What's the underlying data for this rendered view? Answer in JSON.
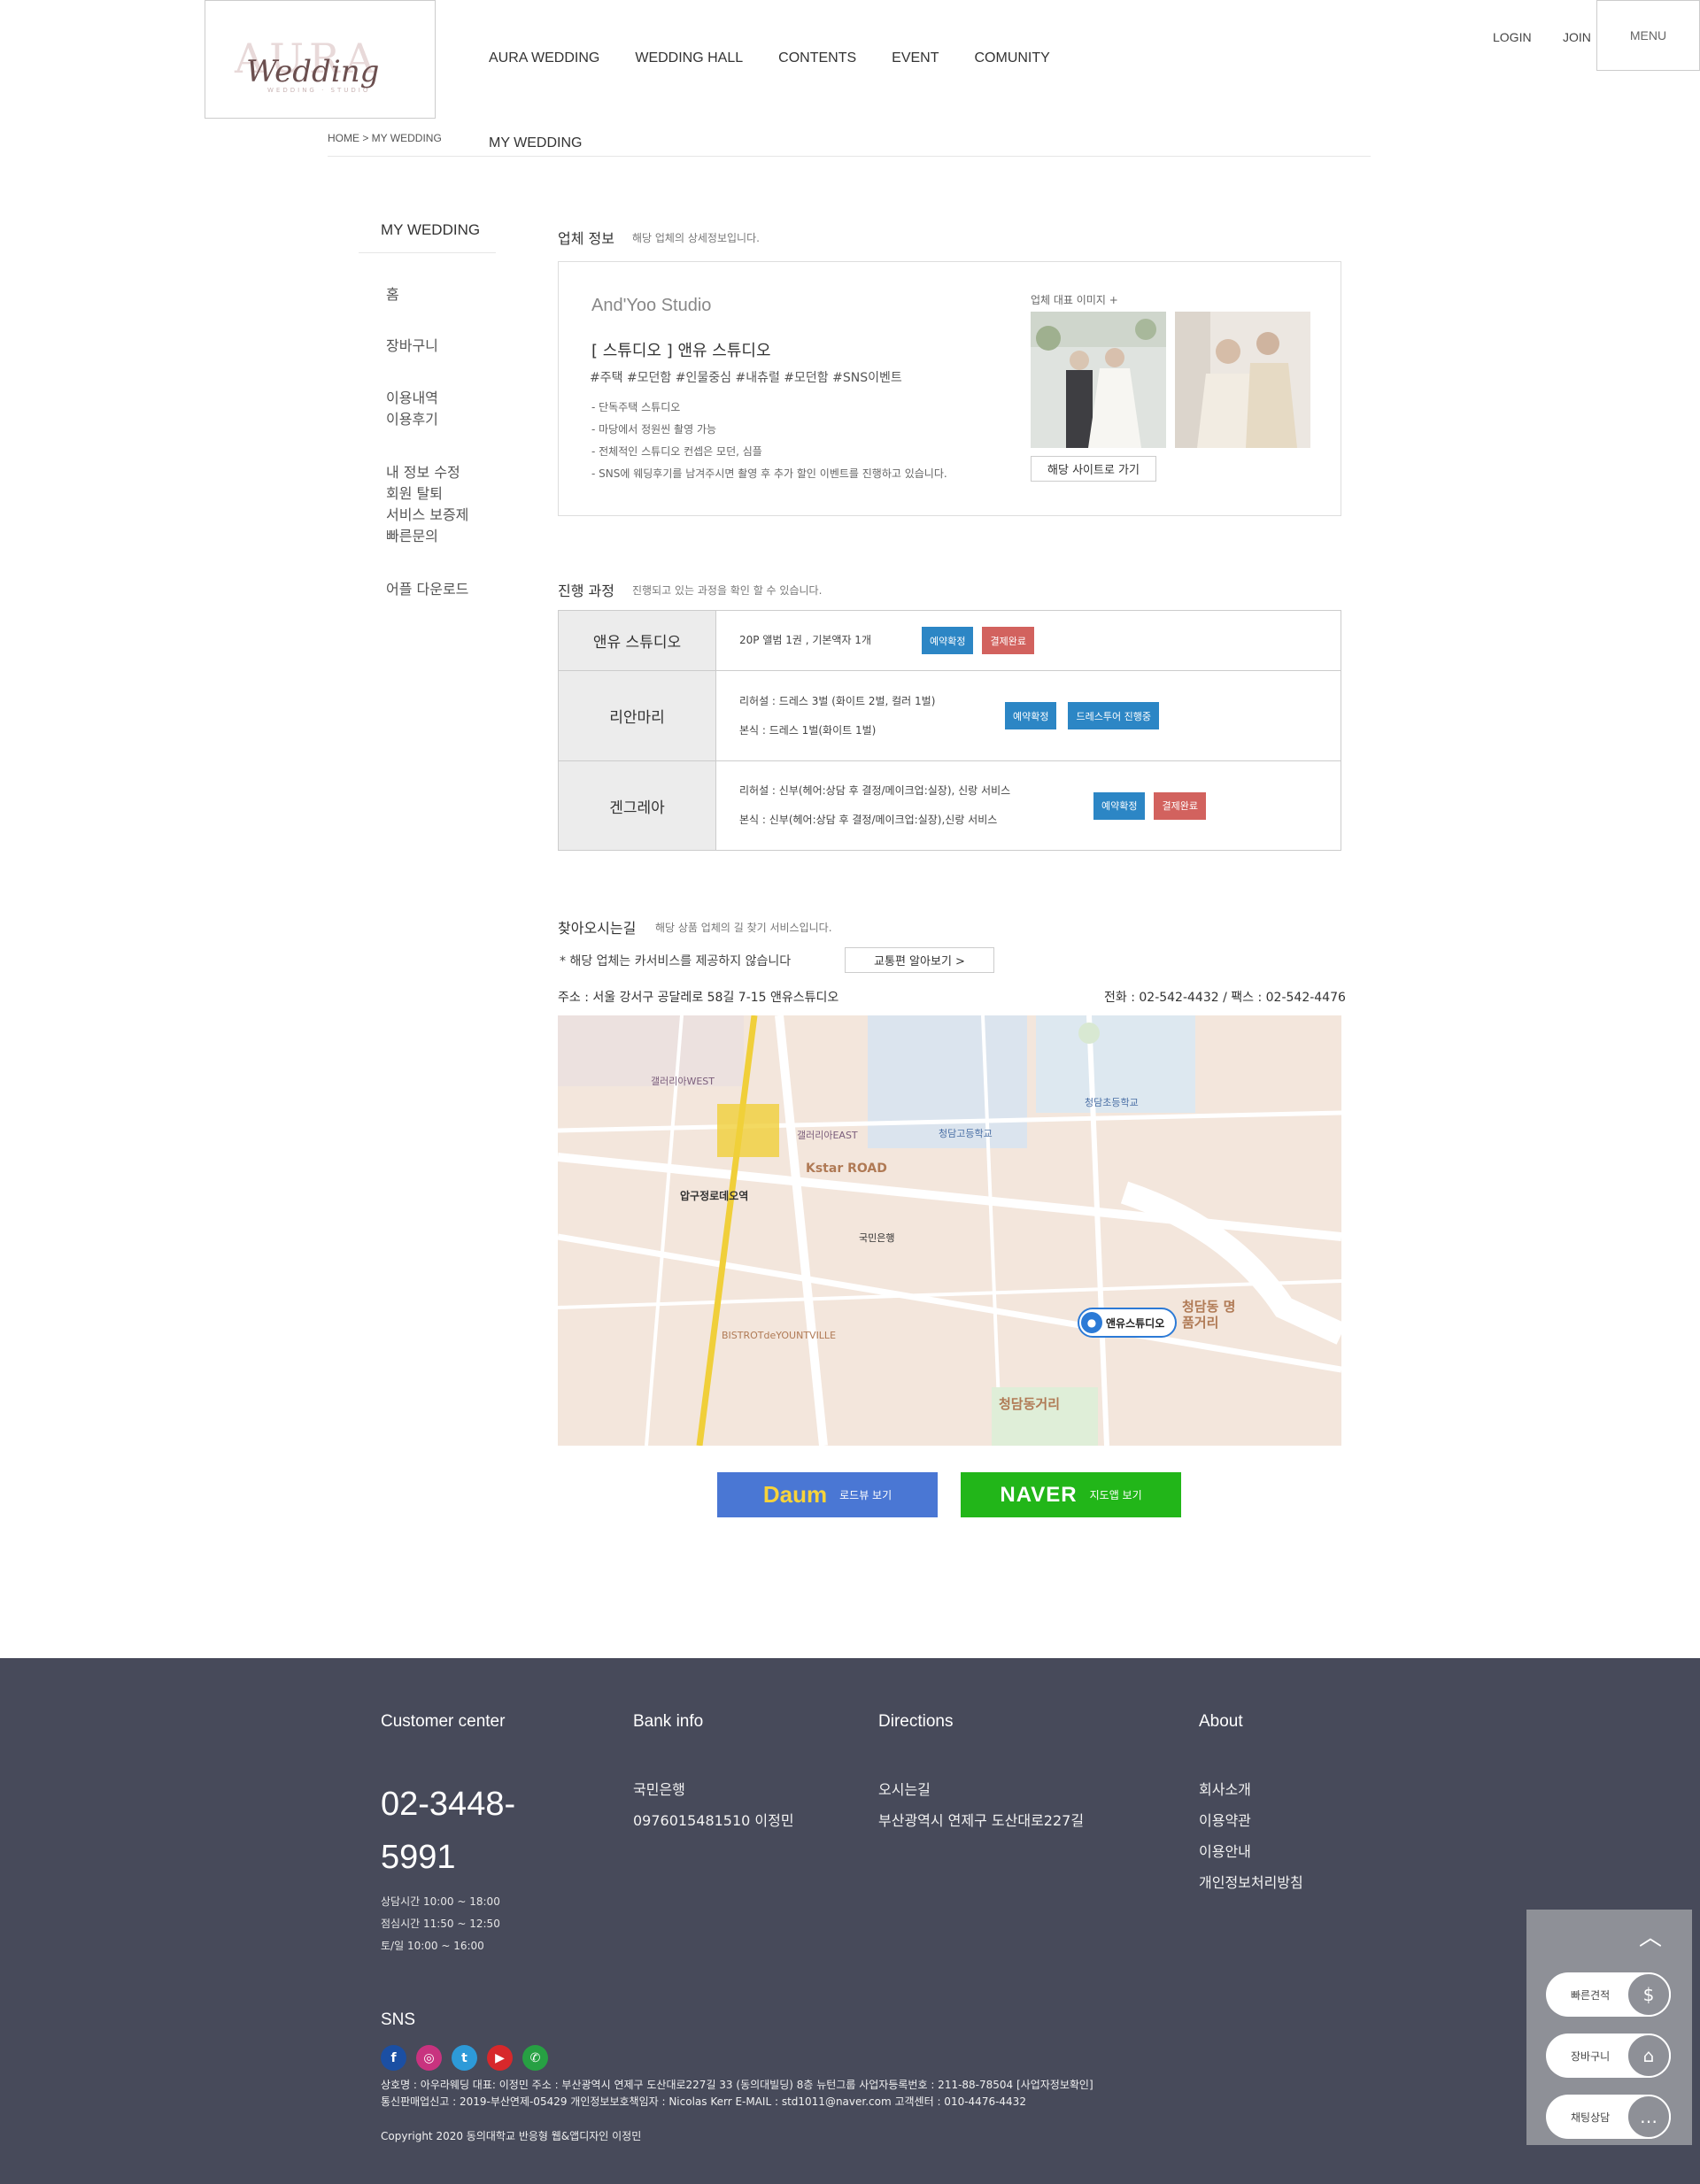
{
  "header": {
    "logo_top": "AURA",
    "logo_script": "Wedding",
    "logo_sub": "WEDDING · STUDIO",
    "nav": [
      "AURA WEDDING",
      "WEDDING HALL",
      "CONTENTS",
      "EVENT",
      "COMUNITY"
    ],
    "login": "LOGIN",
    "join": "JOIN",
    "menu": "MENU"
  },
  "breadcrumb": "HOME > MY WEDDING",
  "page_title": "MY WEDDING",
  "sidebar": {
    "title": "MY WEDDING",
    "items": [
      "홈",
      "장바구니",
      "이용내역",
      "이용후기",
      "내 정보 수정",
      "회원 탈퇴",
      "서비스 보증제",
      "빠른문의",
      "어플 다운로드"
    ]
  },
  "company": {
    "title": "업체 정보",
    "subtitle": "해당 업체의 상세정보입니다.",
    "name_en": "And'Yoo Studio",
    "name_ko": "[ 스튜디오 ] 앤유 스튜디오",
    "tags": "#주택 #모던함 #인물중심 #내츄럴 #모던함 #SNS이벤트",
    "desc": [
      "- 단독주택 스튜디오",
      "- 마당에서 정원씬 촬영 가능",
      "- 전체적인 스튜디오 컨셉은 모던, 심플",
      "- SNS에 웨딩후기를 남겨주시면 촬영 후 추가 할인 이벤트를 진행하고 있습니다."
    ],
    "image_label": "업체 대표 이미지 +",
    "site_button": "해당 사이트로 가기"
  },
  "progress": {
    "title": "진행 과정",
    "subtitle": "진행되고 있는 과정을 확인 할 수 있습니다.",
    "rows": [
      {
        "name": "앤유 스튜디오",
        "lines": [
          "20P 앨범 1권 , 기본액자 1개"
        ],
        "badges": [
          "예약확정",
          "결제완료"
        ]
      },
      {
        "name": "리안마리",
        "lines": [
          "리허설 : 드레스 3벌 (화이트 2벌, 컬러 1벌)",
          "본식 : 드레스 1벌(화이트 1벌)"
        ],
        "badges": [
          "예약확정",
          "드레스투어 진행중"
        ]
      },
      {
        "name": "겐그레아",
        "lines": [
          "리허설 : 신부(헤어:상담 후 결정/메이크업:실장), 신랑 서비스",
          "본식 : 신부(헤어:상담 후 결정/메이크업:실장),신랑 서비스"
        ],
        "badges": [
          "예약확정",
          "결제완료"
        ]
      }
    ]
  },
  "directions": {
    "title": "찾아오시는길",
    "subtitle": "해당 상품 업체의 길 찾기 서비스입니다.",
    "notice": "* 해당 업체는 카서비스를 제공하지 않습니다",
    "traffic_button": "교통편 알아보기 >",
    "address": "주소 : 서울 강서구 공달레로 58길 7-15 앤유스튜디오",
    "tel": "전화 : 02-542-4432 / 팩스 : 02-542-4476",
    "map_labels": {
      "station": "압구정로데오역",
      "road": "Kstar ROAD",
      "pin": "앤유스튜디오",
      "area": "청담동 명품거리",
      "street": "청담동거리",
      "bank": "국민은행",
      "gallery_w": "갤러리아WEST",
      "gallery_e": "갤러리아EAST",
      "bistrot": "BISTROTdeYOUNTVILLE",
      "school": "청담고등학교",
      "school2": "청담초등학교"
    },
    "daum_logo": "Daum",
    "daum_label": "로드뷰 보기",
    "naver_logo": "NAVER",
    "naver_label": "지도앱 보기"
  },
  "footer": {
    "customer": {
      "title": "Customer center",
      "phone_1": "02-3448-",
      "phone_2": "5991",
      "hours": [
        "상담시간 10:00 ~ 18:00",
        "점심시간 11:50 ~ 12:50",
        "토/일 10:00 ~ 16:00"
      ]
    },
    "bank": {
      "title": "Bank info",
      "lines": [
        "국민은행",
        "0976015481510 이정민"
      ]
    },
    "directions": {
      "title": "Directions",
      "lines": [
        "오시는길",
        "부산광역시 연제구 도산대로227길"
      ]
    },
    "about": {
      "title": "About",
      "lines": [
        "회사소개",
        "이용약관",
        "이용안내",
        "개인정보처리방침"
      ]
    },
    "sns_title": "SNS",
    "info_1": "상호명 : 아우라웨딩 대표: 이정민 주소 : 부산광역시 연제구 도산대로227길 33 (동의대빌딩) 8층 뉴턴그룹 사업자등록번호 : 211-88-78504 [사업자정보확인]",
    "info_2": "통신판매업신고 : 2019-부산연제-05429 개인정보보호책임자 : Nicolas Kerr E-MAIL : std1011@naver.com 고객센터 : 010-4476-4432",
    "copyright": "Copyright 2020 동의대학교 반응형 웹&앱디자인 이정민"
  },
  "quick": {
    "items": [
      "빠른견적",
      "장바구니",
      "채팅상담"
    ]
  }
}
